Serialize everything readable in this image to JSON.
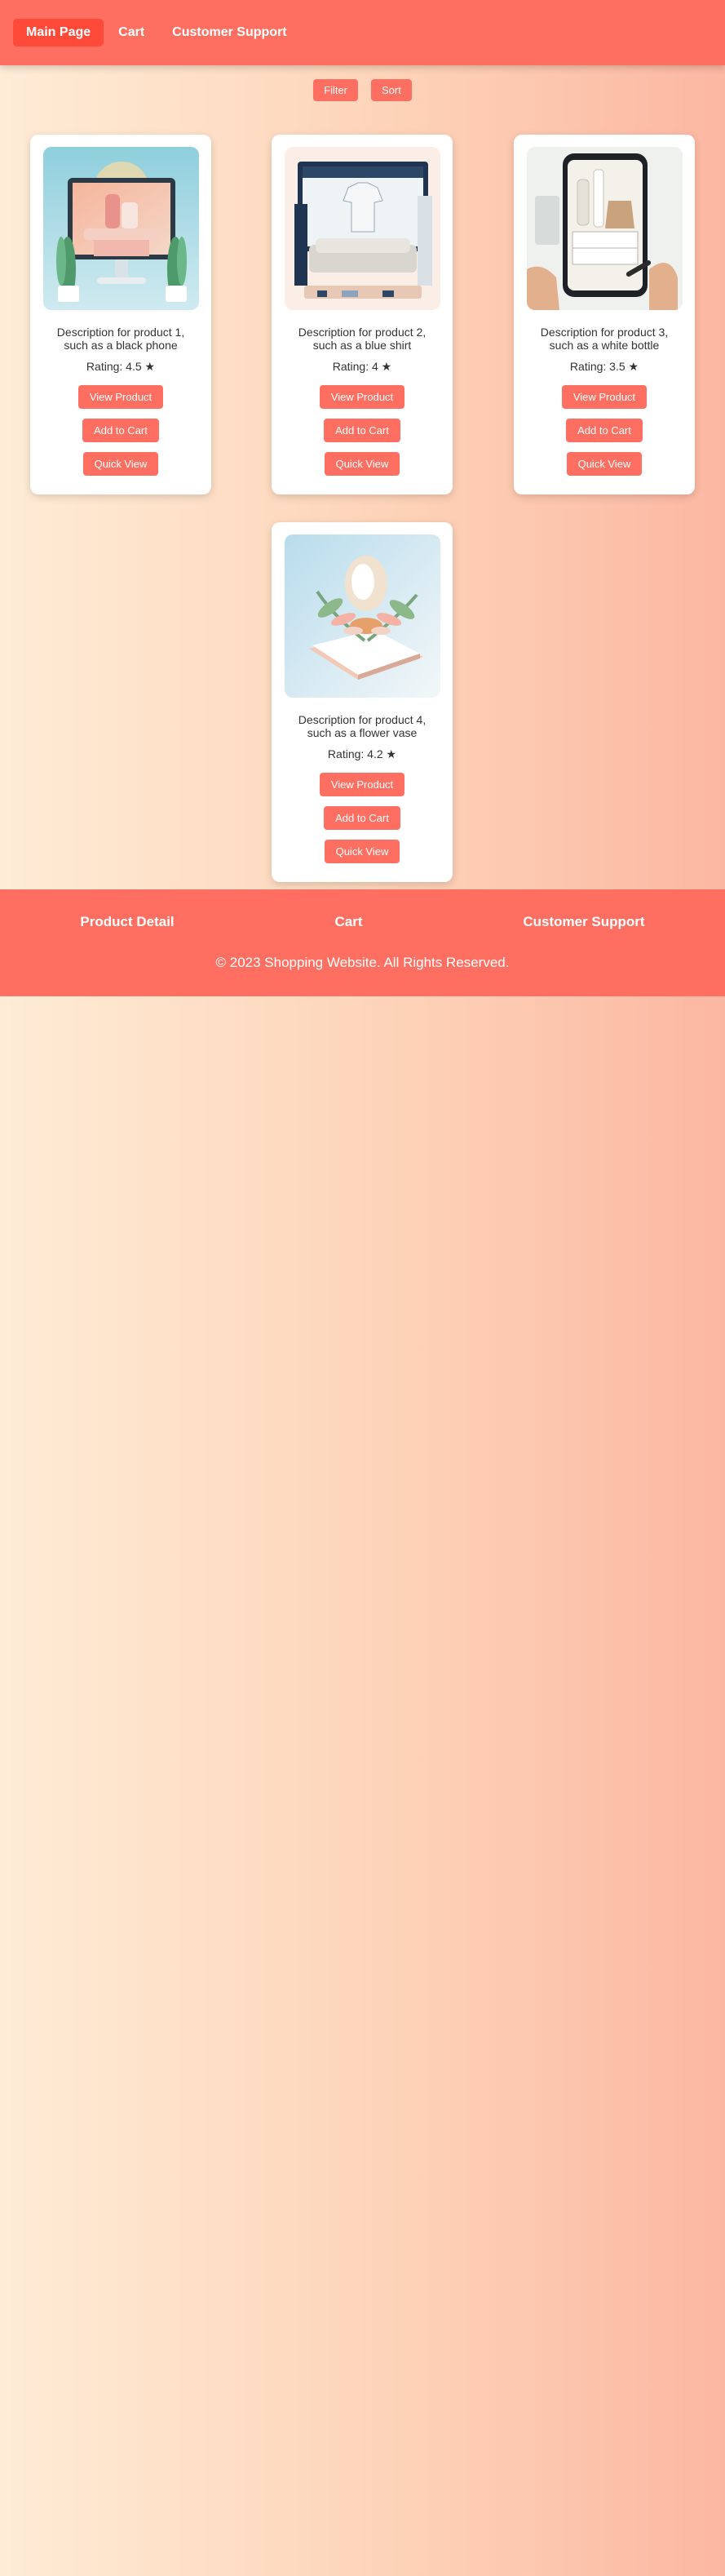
{
  "nav": {
    "items": [
      {
        "label": "Main Page"
      },
      {
        "label": "Cart"
      },
      {
        "label": "Customer Support"
      }
    ]
  },
  "controls": {
    "filter_label": "Filter",
    "sort_label": "Sort"
  },
  "products": [
    {
      "description": "Description for product 1, such as a black phone",
      "rating": "Rating: 4.5 ★"
    },
    {
      "description": "Description for product 2, such as a blue shirt",
      "rating": "Rating: 4 ★"
    },
    {
      "description": "Description for product 3, such as a white bottle",
      "rating": "Rating: 3.5 ★"
    },
    {
      "description": "Description for product 4, such as a flower vase",
      "rating": "Rating: 4.2 ★"
    }
  ],
  "card_buttons": {
    "view": "View Product",
    "cart": "Add to Cart",
    "quick": "Quick View"
  },
  "footer": {
    "links": [
      {
        "label": "Product Detail"
      },
      {
        "label": "Cart"
      },
      {
        "label": "Customer Support"
      }
    ],
    "copyright": "© 2023 Shopping Website. All Rights Reserved."
  },
  "colors": {
    "accent": "#ff6f61",
    "accent_active": "#ff4a3a"
  }
}
